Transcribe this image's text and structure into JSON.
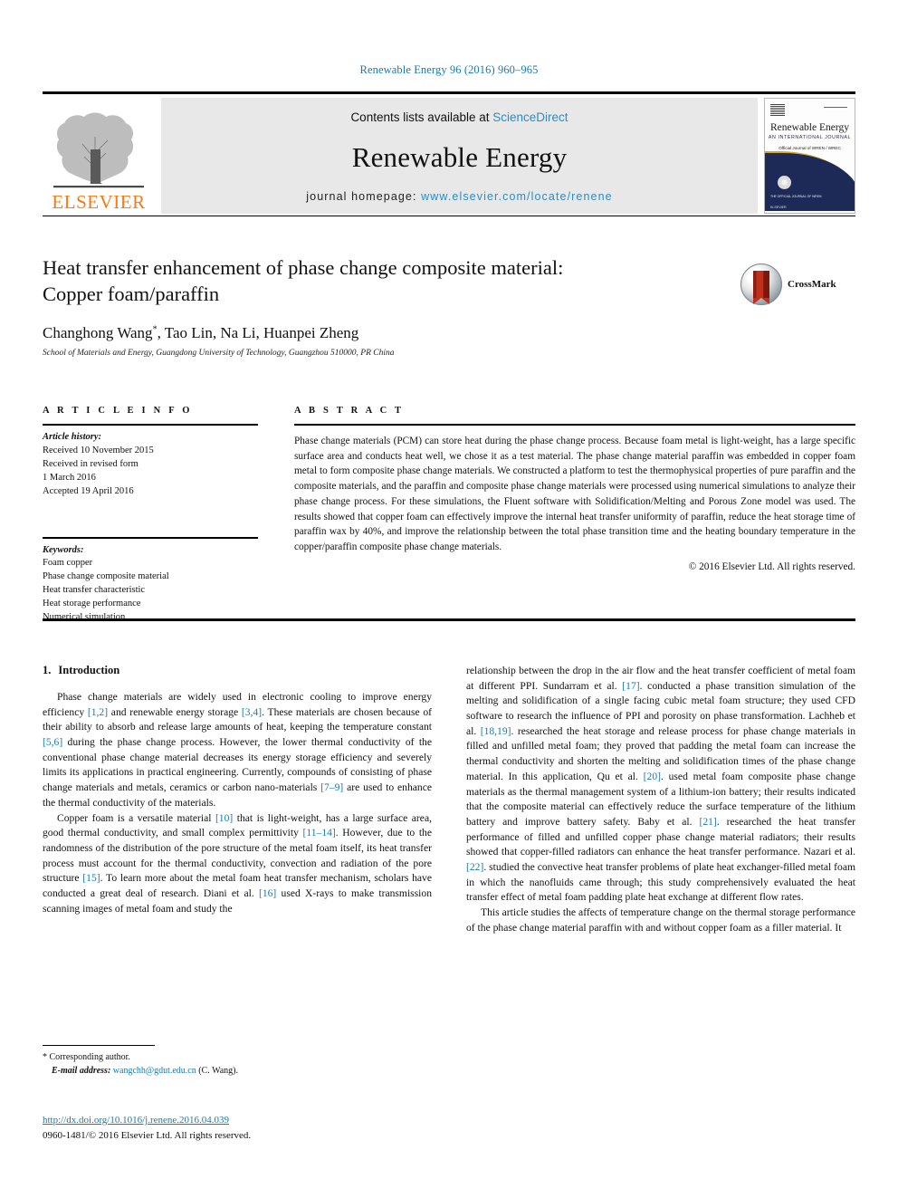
{
  "running_head": "Renewable Energy 96 (2016) 960–965",
  "masthead": {
    "contents_prefix": "Contents lists available at ",
    "contents_link": "ScienceDirect",
    "journal_name": "Renewable Energy",
    "homepage_prefix": "journal homepage: ",
    "homepage_url": "www.elsevier.com/locate/renene",
    "publisher_name": "ELSEVIER",
    "cover": {
      "title": "Renewable Energy",
      "subtitle": "AN INTERNATIONAL JOURNAL",
      "tagline": "Official Journal of WREN / WREC",
      "badge_text": "THE OFFICIAL JOURNAL OF WREN",
      "bottom_text": "ELSEVIER"
    },
    "colors": {
      "link": "#2b8dc4",
      "band": "#e8e8e8",
      "elsevier_orange": "#ef7d1a",
      "cover_navy": "#1d2a58",
      "cover_gold": "#d4a62a"
    }
  },
  "article": {
    "title_line1": "Heat transfer enhancement of phase change composite material:",
    "title_line2": "Copper foam/paraffin",
    "authors": "Changhong Wang",
    "author_marker": "*",
    "authors_rest": ", Tao Lin, Na Li, Huanpei Zheng",
    "affiliation": "School of Materials and Energy, Guangdong University of Technology, Guangzhou 510000, PR China",
    "crossmark_label": "CrossMark"
  },
  "article_info": {
    "heading": "A R T I C L E  I N F O",
    "history_label": "Article history:",
    "history": [
      "Received 10 November 2015",
      "Received in revised form",
      "1 March 2016",
      "Accepted 19 April 2016"
    ],
    "keywords_label": "Keywords:",
    "keywords": [
      "Foam copper",
      "Phase change composite material",
      "Heat transfer characteristic",
      "Heat storage performance",
      "Numerical simulation"
    ]
  },
  "abstract": {
    "heading": "A B S T R A C T",
    "text": "Phase change materials (PCM) can store heat during the phase change process. Because foam metal is light-weight, has a large specific surface area and conducts heat well, we chose it as a test material. The phase change material paraffin was embedded in copper foam metal to form composite phase change materials. We constructed a platform to test the thermophysical properties of pure paraffin and the composite materials, and the paraffin and composite phase change materials were processed using numerical simulations to analyze their phase change process. For these simulations, the Fluent software with Solidification/Melting and Porous Zone model was used. The results showed that copper foam can effectively improve the internal heat transfer uniformity of paraffin, reduce the heat storage time of paraffin wax by 40%, and improve the relationship between the total phase transition time and the heating boundary temperature in the copper/paraffin composite phase change materials.",
    "copyright": "© 2016 Elsevier Ltd. All rights reserved."
  },
  "body": {
    "section_number": "1.",
    "section_title": "Introduction",
    "left_paragraphs": [
      {
        "segments": [
          {
            "t": "Phase change materials are widely used in electronic cooling to improve energy efficiency ",
            "k": "text"
          },
          {
            "t": "[1,2]",
            "k": "ref"
          },
          {
            "t": " and renewable energy storage ",
            "k": "text"
          },
          {
            "t": "[3,4]",
            "k": "ref"
          },
          {
            "t": ". These materials are chosen because of their ability to absorb and release large amounts of heat, keeping the temperature constant ",
            "k": "text"
          },
          {
            "t": "[5,6]",
            "k": "ref"
          },
          {
            "t": " during the phase change process. However, the lower thermal conductivity of the conventional phase change material decreases its energy storage efficiency and severely limits its applications in practical engineering. Currently, compounds of consisting of phase change materials and metals, ceramics or carbon nano-materials ",
            "k": "text"
          },
          {
            "t": "[7–9]",
            "k": "ref"
          },
          {
            "t": " are used to enhance the thermal conductivity of the materials.",
            "k": "text"
          }
        ]
      },
      {
        "segments": [
          {
            "t": "Copper foam is a versatile material ",
            "k": "text"
          },
          {
            "t": "[10]",
            "k": "ref"
          },
          {
            "t": " that is light-weight, has a large surface area, good thermal conductivity, and small complex permittivity ",
            "k": "text"
          },
          {
            "t": "[11–14]",
            "k": "ref"
          },
          {
            "t": ". However, due to the randomness of the distribution of the pore structure of the metal foam itself, its heat transfer process must account for the thermal conductivity, convection and radiation of the pore structure ",
            "k": "text"
          },
          {
            "t": "[15]",
            "k": "ref"
          },
          {
            "t": ". To learn more about the metal foam heat transfer mechanism, scholars have conducted a great deal of research. Diani et al. ",
            "k": "text"
          },
          {
            "t": "[16]",
            "k": "ref"
          },
          {
            "t": " used X-rays to make transmission scanning images of metal foam and study the",
            "k": "text"
          }
        ]
      }
    ],
    "right_paragraphs": [
      {
        "no_indent": true,
        "segments": [
          {
            "t": "relationship between the drop in the air flow and the heat transfer coefficient of metal foam at different PPI. Sundarram et al. ",
            "k": "text"
          },
          {
            "t": "[17]",
            "k": "ref"
          },
          {
            "t": ". conducted a phase transition simulation of the melting and solidification of a single facing cubic metal foam structure; they used CFD software to research the influence of PPI and porosity on phase transformation. Lachheb et al. ",
            "k": "text"
          },
          {
            "t": "[18,19]",
            "k": "ref"
          },
          {
            "t": ". researched the heat storage and release process for phase change materials in filled and unfilled metal foam; they proved that padding the metal foam can increase the thermal conductivity and shorten the melting and solidification times of the phase change material. In this application, Qu et al. ",
            "k": "text"
          },
          {
            "t": "[20]",
            "k": "ref"
          },
          {
            "t": ". used metal foam composite phase change materials as the thermal management system of a lithium-ion battery; their results indicated that the composite material can effectively reduce the surface temperature of the lithium battery and improve battery safety. Baby et al. ",
            "k": "text"
          },
          {
            "t": "[21]",
            "k": "ref"
          },
          {
            "t": ". researched the heat transfer performance of filled and unfilled copper phase change material radiators; their results showed that copper-filled radiators can enhance the heat transfer performance. Nazari et al. ",
            "k": "text"
          },
          {
            "t": "[22]",
            "k": "ref"
          },
          {
            "t": ". studied the convective heat transfer problems of plate heat exchanger-filled metal foam in which the nanofluids came through; this study comprehensively evaluated the heat transfer effect of metal foam padding plate heat exchange at different flow rates.",
            "k": "text"
          }
        ]
      },
      {
        "segments": [
          {
            "t": "This article studies the affects of temperature change on the thermal storage performance of the phase change material paraffin with and without copper foam as a filler material. It",
            "k": "text"
          }
        ]
      }
    ]
  },
  "footnotes": {
    "corresponding_marker": "*",
    "corresponding_text": "Corresponding author.",
    "email_label": "E-mail address:",
    "email": "wangchh@gdut.edu.cn",
    "email_suffix": "(C. Wang).",
    "doi": "http://dx.doi.org/10.1016/j.renene.2016.04.039",
    "issn_line": "0960-1481/© 2016 Elsevier Ltd. All rights reserved."
  }
}
